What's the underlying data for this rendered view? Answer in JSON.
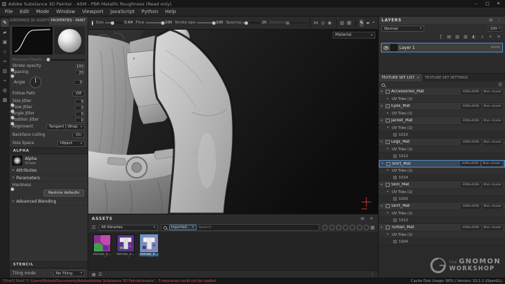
{
  "icons": {
    "chevron_down": "▾",
    "chevron_right": "▸",
    "close": "✕",
    "minimize": "–",
    "maximize": "□",
    "burger": "☰",
    "dots": "⋮",
    "plus": "+",
    "grid": "▦",
    "pin": "⊞",
    "tool_paint": "✎",
    "tool_eraser": "▰",
    "tool_projection": "▣",
    "tool_polygon_fill": "◇",
    "tool_smudge": "≈",
    "tool_clone": "▥",
    "tool_picker": "⌖",
    "tool_mask": "◍",
    "tool_geometry": "▩",
    "tb_symmetry": "⋈",
    "tb_lazy": "◎",
    "tb_stamp": "◉",
    "tb_fill": "▧",
    "tb_settings": "*",
    "ly_fx": "ƒ",
    "ly_layer": "▤",
    "ly_fill": "▧",
    "ly_folder": "▨",
    "ly_mask": "◐",
    "ly_import": "↓",
    "ly_trash": "✕"
  },
  "window": {
    "title": "Adobe Substance 3D Painter - ASM - PBR Metallic Roughness (Read only)"
  },
  "menu": {
    "items": [
      "File",
      "Edit",
      "Mode",
      "Window",
      "Viewport",
      "JavaScript",
      "Python",
      "Help"
    ]
  },
  "toolbar": {
    "size_label": "Size",
    "size_value": "0.64",
    "flow_label": "Flow",
    "flow_value": "100",
    "stroke_label": "Stroke opa",
    "stroke_value": "100",
    "spacing_label": "Spacing",
    "spacing_value": "20",
    "distance_label": "Distance"
  },
  "viewport": {
    "material_label": "Material"
  },
  "properties": {
    "tab_assets": "SUBSTANCE 3D ASSETS",
    "tab_properties": "PROPERTIES - PAINT",
    "min_flow_label": "Minimum Flow/Si...",
    "stroke_opacity": {
      "label": "Stroke opacity",
      "value": "100"
    },
    "spacing": {
      "label": "Spacing",
      "value": "20"
    },
    "angle": {
      "label": "Angle",
      "value": "0"
    },
    "follow_path": {
      "label": "Follow Path",
      "value": "Off"
    },
    "size_jitter": {
      "label": "Size jitter",
      "value": "0"
    },
    "flow_jitter": {
      "label": "Flow jitter",
      "value": "0"
    },
    "angle_jitter": {
      "label": "Angle jitter",
      "value": "0"
    },
    "position_jitter": {
      "label": "Position jitter",
      "value": "0"
    },
    "alignment": {
      "label": "Alignment",
      "value": "Tangent | Wrap"
    },
    "backface": {
      "label": "Backface culling",
      "value": "On"
    },
    "size_space": {
      "label": "Size Space",
      "value": "Object"
    },
    "alpha_title": "ALPHA",
    "alpha_name": "Alpha",
    "alpha_sub": "Shape",
    "attributes_label": "Attributes",
    "parameters_label": "Parameters",
    "hardness_label": "Hardness",
    "restore_defaults": "Restore defaults",
    "advanced_blending": "Advanced Blending",
    "stencil_title": "STENCIL",
    "tiling_label": "Tiling mode",
    "tiling_value": "No Tiling"
  },
  "layers": {
    "title": "LAYERS",
    "blend_mode": "Normal",
    "opacity": "100",
    "layer_name": "Layer 1",
    "layer_channels": "NRMR"
  },
  "texture_sets": {
    "tab_list": "TEXTURE SET LIST",
    "tab_settings": "TEXTURE SET SETTINGS",
    "sets": [
      {
        "name": "Accessories_Mat",
        "res": "4096x4096",
        "shader": "Main shader",
        "uv": "UV Tiles (1)",
        "udim": ""
      },
      {
        "name": "Eyes_Mat",
        "res": "4096x4096",
        "shader": "Main shader",
        "uv": "UV Tiles (1)",
        "udim": ""
      },
      {
        "name": "Jacket_Mat",
        "res": "4096x4096",
        "shader": "Main shader",
        "uv": "UV Tiles (1)",
        "udim": "1013"
      },
      {
        "name": "Legs_Mat",
        "res": "4096x4096",
        "shader": "Main shader",
        "uv": "UV Tiles (1)",
        "udim": "1013"
      },
      {
        "name": "Shirt_Mat",
        "res": "4096x4096",
        "shader": "Main shader",
        "uv": "UV Tiles (1)",
        "udim": "1014"
      },
      {
        "name": "Skin_Mat",
        "res": "4096x4096",
        "shader": "Main shader",
        "uv": "UV Tiles (1)",
        "udim": "1003"
      },
      {
        "name": "Skirt_Mat",
        "res": "4096x4096",
        "shader": "Main shader",
        "uv": "UV Tiles (1)",
        "udim": "1013"
      },
      {
        "name": "Turban_Mat",
        "res": "4096x4096",
        "shader": "Main shader",
        "uv": "UV Tiles (1)",
        "udim": "1004"
      }
    ]
  },
  "assets": {
    "title": "ASSETS",
    "library": "All libraries",
    "filter_tag": "imported...",
    "search_placeholder": "Search",
    "items": [
      {
        "name": "Mohab_b..."
      },
      {
        "name": "Mohab_b..."
      },
      {
        "name": "Mohab_b..."
      }
    ]
  },
  "status": {
    "message": "[Shelf] Shelf 'C:/Users/Mohab/Documents/Adobe/Adobe Substance 3D Painter/assets' : 3 resources could not be loaded",
    "info": "Cache Disk Usage: 66% | Version: 10.1.1 (OpenGL)"
  },
  "watermark": {
    "the": "THE",
    "gnomon": "GNOMON",
    "workshop": "WORKSHOP"
  }
}
